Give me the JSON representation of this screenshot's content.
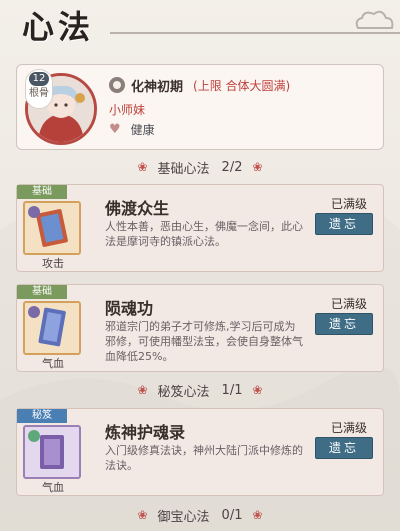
{
  "title": "心法",
  "profile": {
    "level": "12",
    "level_label": "根骨",
    "realm": "化神初期",
    "limit": "(上限 合体大圆满)",
    "name": "小师妹",
    "health": "健康"
  },
  "sections": [
    {
      "label": "基础心法",
      "count": "2/2",
      "skills": [
        {
          "tag": "基础",
          "name": "佛渡众生",
          "type": "攻击",
          "status": "已满级",
          "button": "遗忘",
          "desc": "人性本善，恶由心生，佛魔一念间，此心法是摩诃寺的镇派心法。"
        },
        {
          "tag": "基础",
          "name": "陨魂功",
          "type": "气血",
          "status": "已满级",
          "button": "遗忘",
          "desc": "邪道宗门的弟子才可修炼,学习后可成为邪修，可使用幡型法宝，会使自身整体气血降低25%。"
        }
      ]
    },
    {
      "label": "秘笈心法",
      "count": "1/1",
      "skills": [
        {
          "tag": "秘笈",
          "name": "炼神护魂录",
          "type": "气血",
          "status": "已满级",
          "button": "遗忘",
          "desc": "入门级修真法诀，神州大陆门派中修炼的法诀。"
        }
      ]
    },
    {
      "label": "御宝心法",
      "count": "0/1",
      "skills": []
    }
  ],
  "colors": {
    "accent_red": "#c0403c",
    "button_blue": "#3f6d86",
    "tag_green": "#7a9a5e",
    "tag_blue": "#4a7fb4"
  }
}
